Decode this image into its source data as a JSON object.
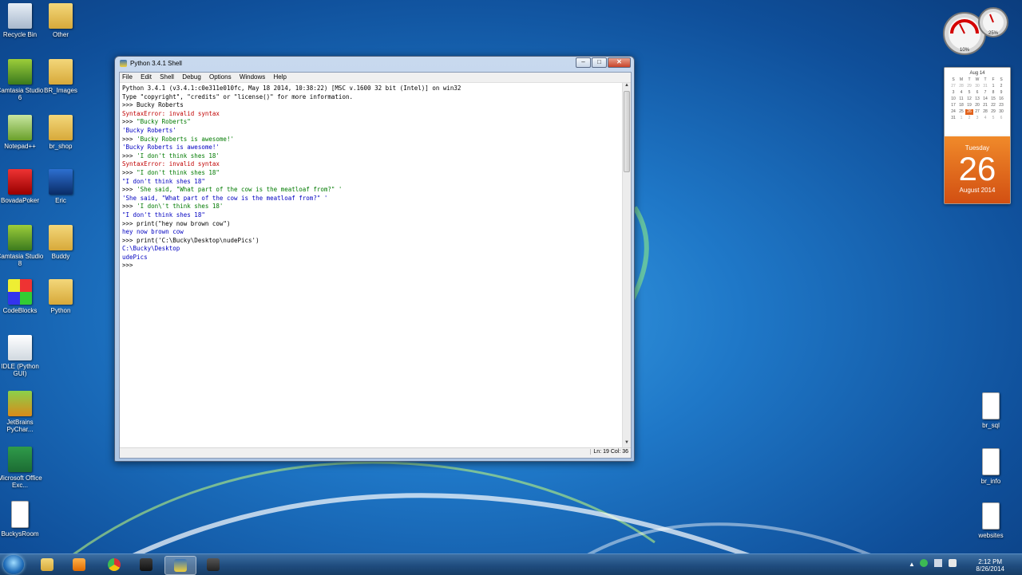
{
  "window": {
    "title": "Python 3.4.1 Shell",
    "menu": [
      "File",
      "Edit",
      "Shell",
      "Debug",
      "Options",
      "Windows",
      "Help"
    ],
    "status": "Ln: 19 Col: 36",
    "lines": [
      "Python 3.4.1 (v3.4.1:c0e311e010fc, May 18 2014, 10:38:22) [MSC v.1600 32 bit (Intel)] on win32",
      "Type \"copyright\", \"credits\" or \"license()\" for more information.",
      ">>> Bucky Roberts",
      "SyntaxError: invalid syntax",
      ">>> \"Bucky Roberts\"",
      "'Bucky Roberts'",
      ">>> 'Bucky Roberts is awesome!'",
      "'Bucky Roberts is awesome!'",
      ">>> 'I don't think shes 18'",
      "SyntaxError: invalid syntax",
      ">>> \"I don't think shes 18\"",
      "\"I don't think shes 18\"",
      ">>> 'She said, \"What part of the cow is the meatloaf from?\" '",
      "'She said, \"What part of the cow is the meatloaf from?\" '",
      ">>> 'I don\\'t think shes 18'",
      "\"I don't think shes 18\"",
      ">>> print(\"hey now brown cow\")",
      "hey now brown cow",
      ">>> print('C:\\Bucky\\Desktop\\nudePics')",
      "C:\\Bucky\\Desktop",
      "udePics",
      ">>> "
    ]
  },
  "desktop_icons": [
    {
      "label": "Recycle Bin",
      "icon": "recycle-bin-icon"
    },
    {
      "label": "Other",
      "icon": "folder-icon"
    },
    {
      "label": "Camtasia Studio 6",
      "icon": "camtasia-icon"
    },
    {
      "label": "BR_Images",
      "icon": "folder-icon"
    },
    {
      "label": "Notepad++",
      "icon": "notepad-icon"
    },
    {
      "label": "br_shop",
      "icon": "folder-icon"
    },
    {
      "label": "BovadaPoker",
      "icon": "poker-icon"
    },
    {
      "label": "Eric",
      "icon": "photoshop-icon"
    },
    {
      "label": "Camtasia Studio 8",
      "icon": "camtasia-icon"
    },
    {
      "label": "Buddy",
      "icon": "folder-icon"
    },
    {
      "label": "CodeBlocks",
      "icon": "codeblocks-icon"
    },
    {
      "label": "Python",
      "icon": "folder-icon"
    },
    {
      "label": "IDLE (Python GUI)",
      "icon": "idle-icon"
    },
    {
      "label": "JetBrains PyChar...",
      "icon": "pycharm-icon"
    },
    {
      "label": "Microsoft Office Exc...",
      "icon": "excel-icon"
    },
    {
      "label": "BuckysRoom",
      "icon": "document-icon"
    },
    {
      "label": "br_sql",
      "icon": "document-icon"
    },
    {
      "label": "br_info",
      "icon": "document-icon"
    },
    {
      "label": "websites",
      "icon": "document-icon"
    }
  ],
  "calendar": {
    "month_label": "Aug 14",
    "weekdays": [
      "S",
      "M",
      "T",
      "W",
      "T",
      "F",
      "S"
    ],
    "days": [
      "27",
      "28",
      "29",
      "30",
      "31",
      "1",
      "2",
      "3",
      "4",
      "5",
      "6",
      "7",
      "8",
      "9",
      "10",
      "11",
      "12",
      "13",
      "14",
      "15",
      "16",
      "17",
      "18",
      "19",
      "20",
      "21",
      "22",
      "23",
      "24",
      "25",
      "26",
      "27",
      "28",
      "29",
      "30",
      "31",
      "1",
      "2",
      "3",
      "4",
      "5",
      "6"
    ],
    "day_name": "Tuesday",
    "day_number": "26",
    "month_year": "August 2014"
  },
  "meter": {
    "cpu": "10%",
    "mem": "25%"
  },
  "taskbar": {
    "time": "2:12 PM",
    "date": "8/26/2014"
  },
  "colors": {
    "error": "#c00000",
    "string": "#007a00",
    "output": "#0000c0",
    "calendar": "#e2631d"
  }
}
